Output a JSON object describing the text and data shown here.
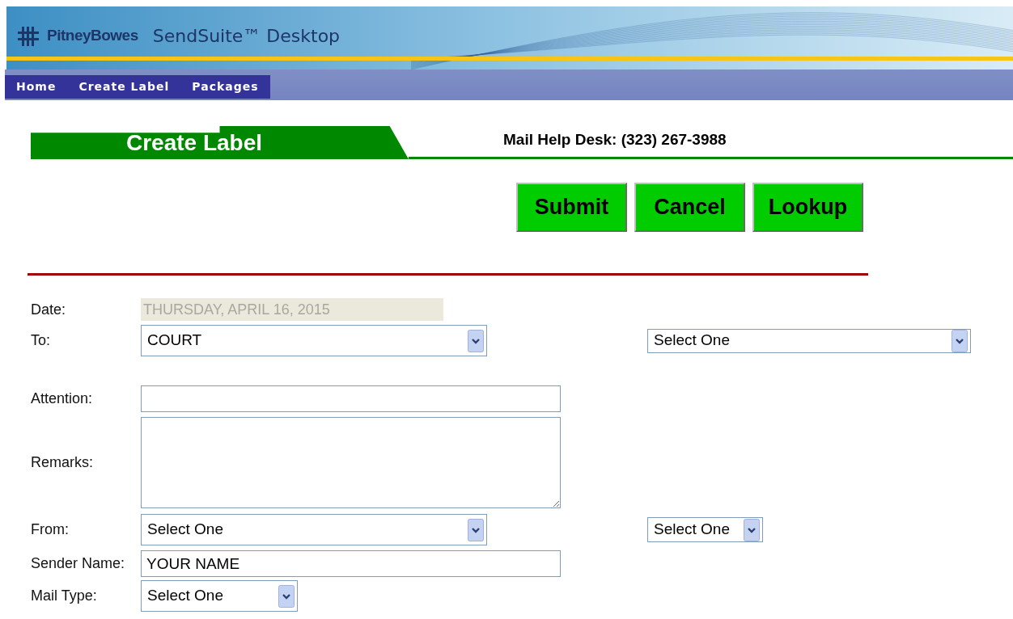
{
  "header": {
    "brand": "PitneyBowes",
    "product": "SendSuite™ Desktop"
  },
  "nav": [
    {
      "label": "Home"
    },
    {
      "label": "Create Label"
    },
    {
      "label": "Packages"
    }
  ],
  "page_title": "Create Label",
  "help_desk": "Mail Help Desk: (323) 267-3988",
  "buttons": [
    "Submit",
    "Cancel",
    "Lookup"
  ],
  "fields": [
    {
      "label": "Date:",
      "kind": "readonly",
      "value": "THURSDAY, APRIL 16, 2015"
    },
    {
      "label": "To:",
      "kind": "select",
      "value": "COURT",
      "extra": {
        "kind": "select",
        "value": "Select One"
      }
    },
    {
      "label": "Attention:",
      "kind": "text"
    },
    {
      "label": "Remarks:",
      "kind": "textarea"
    },
    {
      "label": "From:",
      "kind": "select",
      "value": "Select One",
      "extra": {
        "kind": "select-small",
        "value": "Select One"
      }
    },
    {
      "label": "Sender Name:",
      "kind": "text",
      "value": "YOUR NAME"
    },
    {
      "label": "Mail Type:",
      "kind": "select-small",
      "value": "Select One"
    }
  ]
}
